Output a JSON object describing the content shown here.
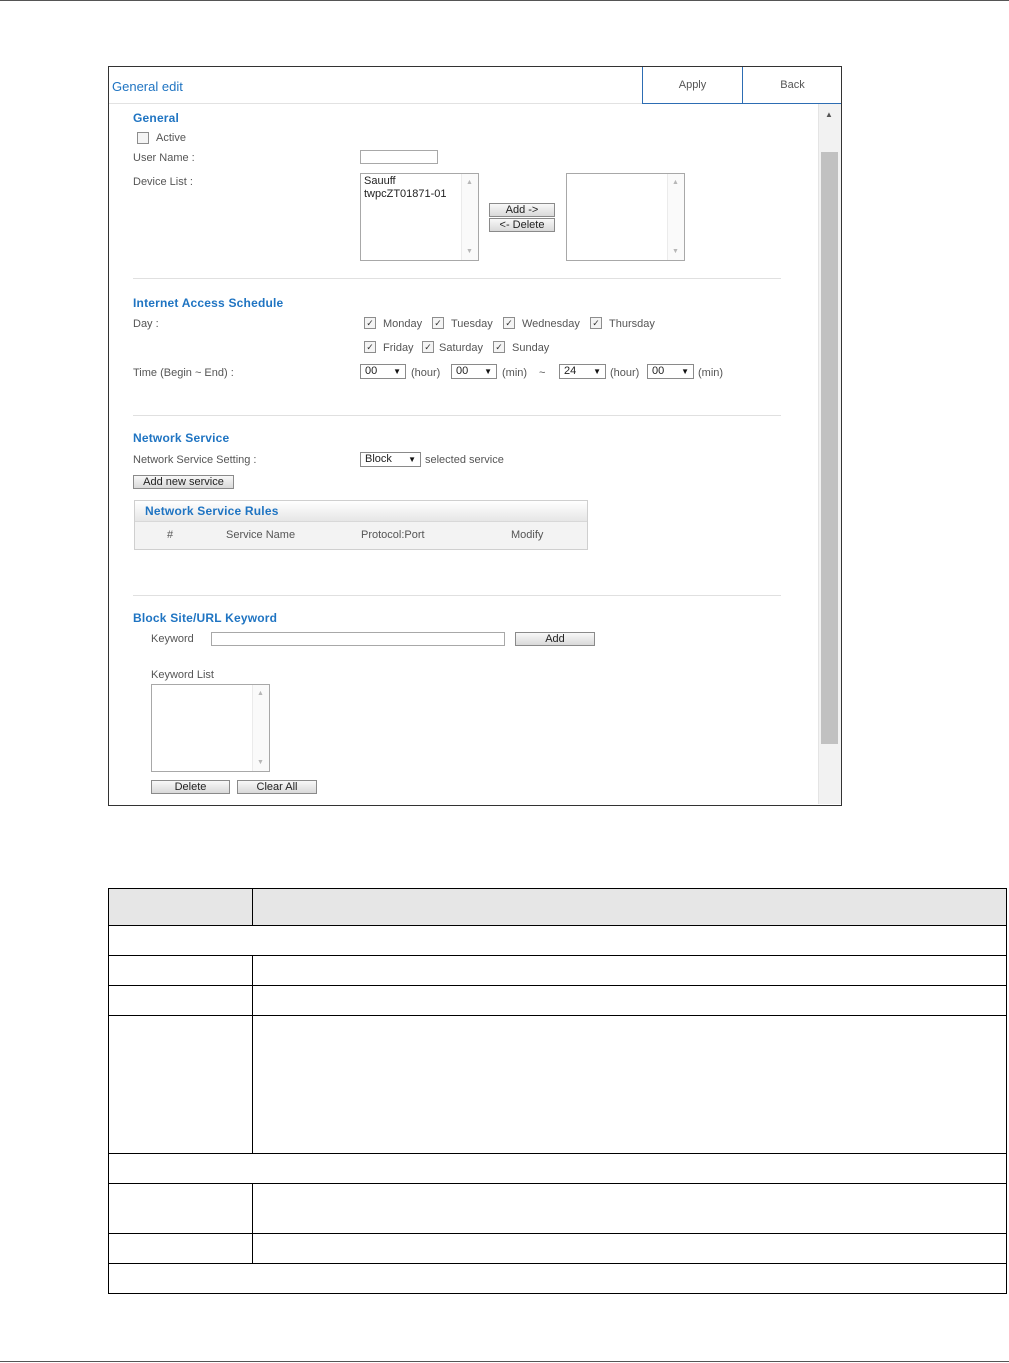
{
  "dialog": {
    "title": "General edit",
    "apply_label": "Apply",
    "back_label": "Back"
  },
  "general": {
    "section_title": "General",
    "active_label": "Active",
    "active_checked": false,
    "user_name_label": "User Name :",
    "user_name_value": "",
    "device_list_label": "Device List :",
    "device_list_items": [
      "Sauuff",
      "twpcZT01871-01"
    ],
    "selected_device_items": [],
    "add_button": "Add ->",
    "delete_button": "<- Delete"
  },
  "schedule": {
    "section_title": "Internet Access Schedule",
    "day_label": "Day :",
    "days": [
      {
        "label": "Monday",
        "checked": true
      },
      {
        "label": "Tuesday",
        "checked": true
      },
      {
        "label": "Wednesday",
        "checked": true
      },
      {
        "label": "Thursday",
        "checked": true
      },
      {
        "label": "Friday",
        "checked": true
      },
      {
        "label": "Saturday",
        "checked": true
      },
      {
        "label": "Sunday",
        "checked": true
      }
    ],
    "time_label": "Time (Begin ~ End) :",
    "begin_hour": "00",
    "begin_min": "00",
    "end_hour": "24",
    "end_min": "00",
    "hour_unit": "(hour)",
    "min_unit": "(min)",
    "separator": "~"
  },
  "network_service": {
    "section_title": "Network Service",
    "setting_label": "Network Service Setting :",
    "setting_value": "Block",
    "setting_suffix": "selected service",
    "add_new_button": "Add new service",
    "rules_title": "Network Service Rules",
    "columns": [
      "#",
      "Service Name",
      "Protocol:Port",
      "Modify"
    ]
  },
  "block_site": {
    "section_title": "Block Site/URL Keyword",
    "keyword_label": "Keyword",
    "keyword_value": "",
    "add_button": "Add",
    "keyword_list_label": "Keyword List",
    "delete_button": "Delete",
    "clear_all_button": "Clear All"
  },
  "icons": {
    "dropdown": "triangle-down",
    "checkmark": "check",
    "scroll_up": "triangle-up",
    "scroll_down": "triangle-down"
  },
  "colors": {
    "accent": "#1f74c2",
    "border_dark": "#333333"
  }
}
